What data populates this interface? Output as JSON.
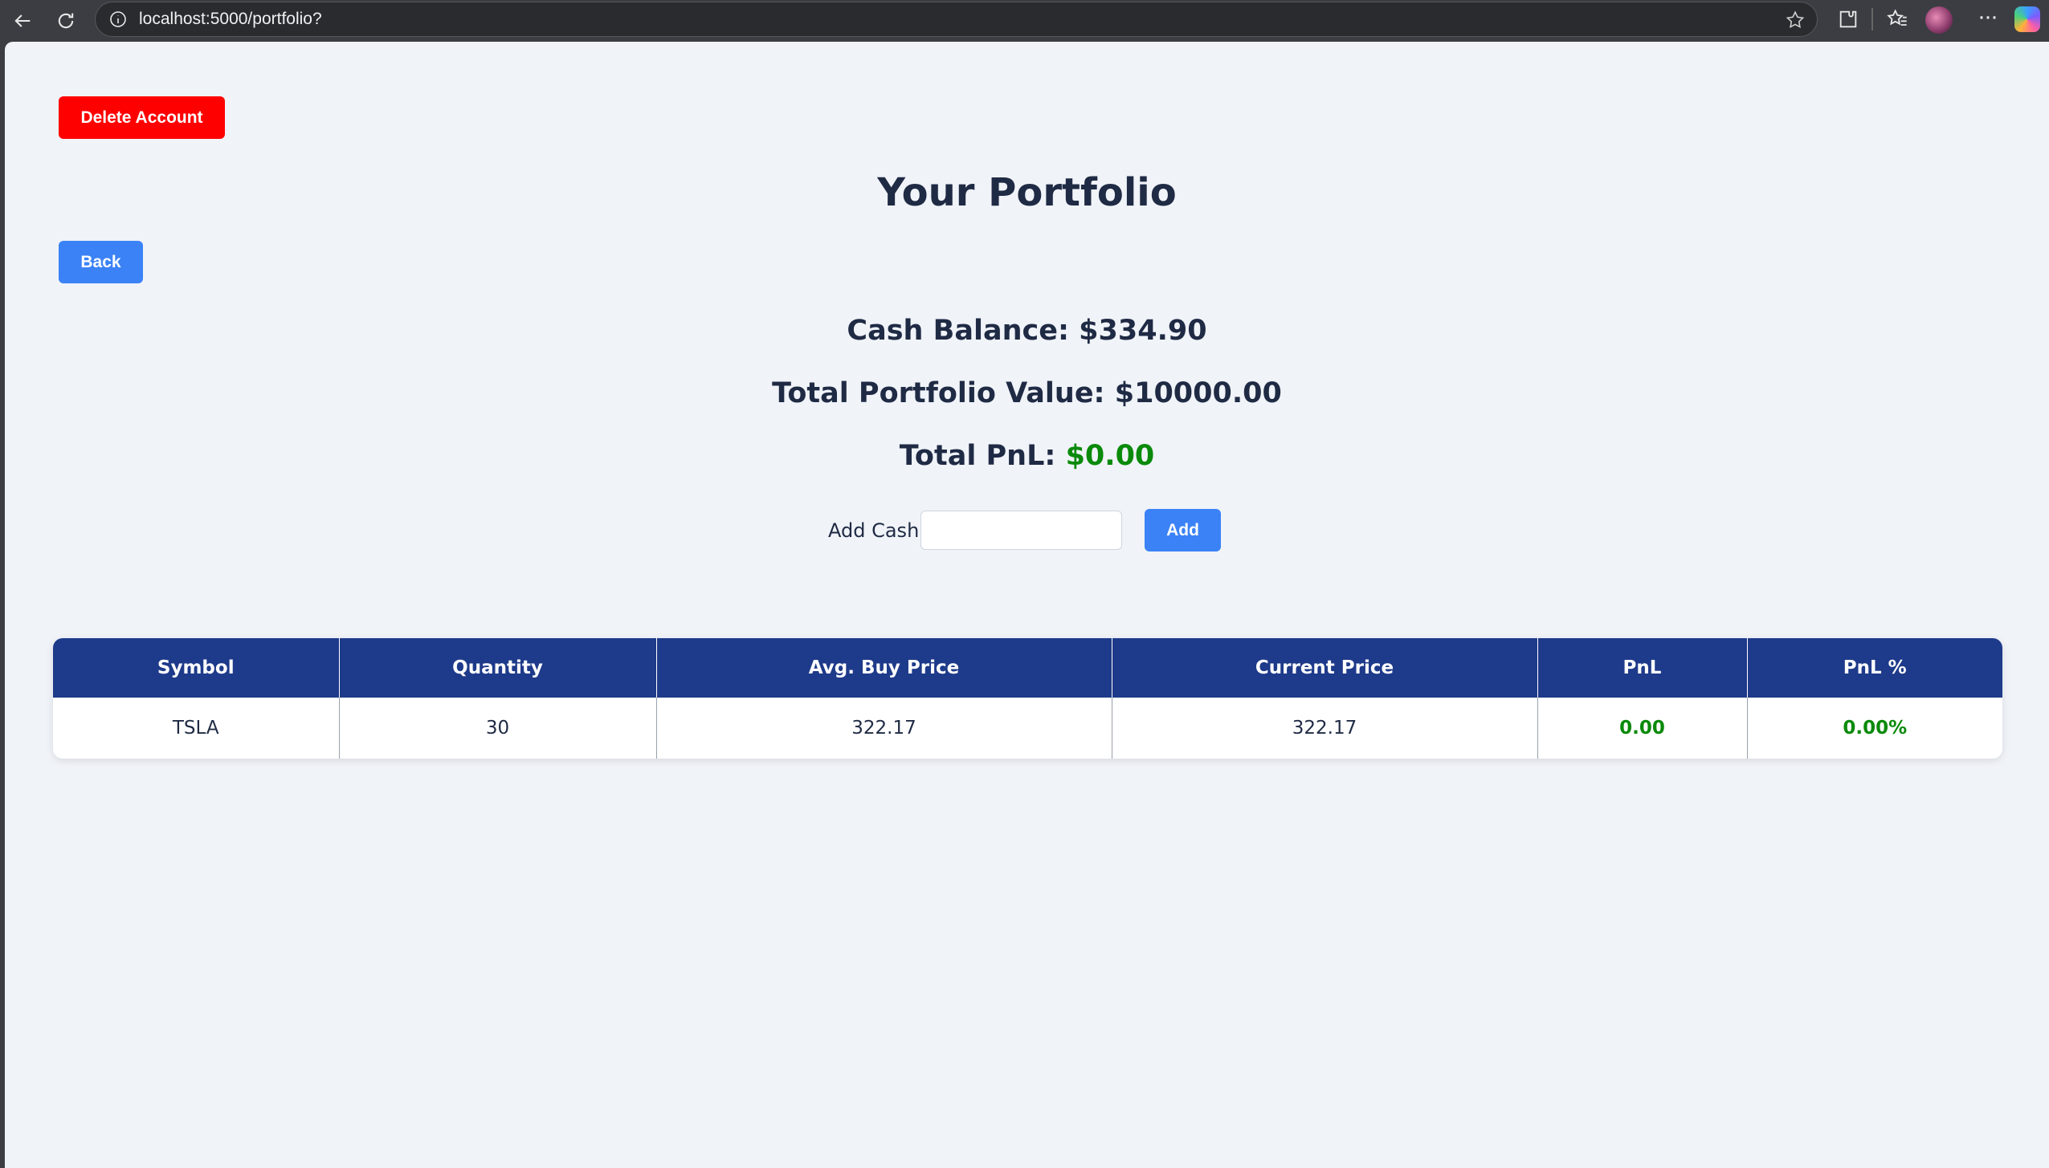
{
  "browser": {
    "url": "localhost:5000/portfolio?"
  },
  "page": {
    "delete_account_label": "Delete Account",
    "back_label": "Back",
    "title": "Your Portfolio",
    "cash_balance_label": "Cash Balance: ",
    "cash_balance_value": "$334.90",
    "total_value_label": "Total Portfolio Value: ",
    "total_value_value": "$10000.00",
    "total_pnl_label": "Total PnL: ",
    "total_pnl_value": "$0.00",
    "add_cash_label": "Add Cash:",
    "add_cash_value": "",
    "add_button_label": "Add"
  },
  "table": {
    "headers": [
      "Symbol",
      "Quantity",
      "Avg. Buy Price",
      "Current Price",
      "PnL",
      "PnL %"
    ],
    "rows": [
      {
        "symbol": "TSLA",
        "quantity": "30",
        "avg_buy_price": "322.17",
        "current_price": "322.17",
        "pnl": "0.00",
        "pnl_pct": "0.00%"
      }
    ]
  },
  "colors": {
    "delete": "#ff0000",
    "primary": "#3b82f6",
    "table_header": "#1e3a8a",
    "positive": "#0a8a0a"
  }
}
